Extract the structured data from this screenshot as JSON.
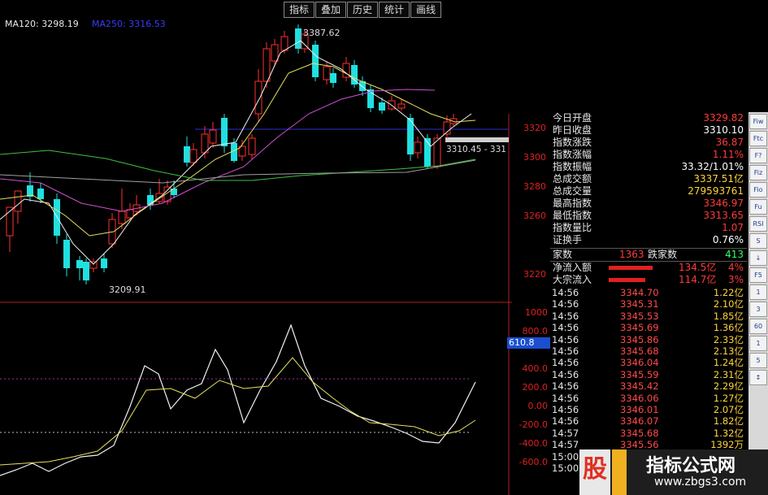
{
  "toolbar": {
    "tabs": [
      "指标",
      "叠加",
      "历史",
      "统计",
      "画线"
    ]
  },
  "ma_labels": [
    {
      "text": "MA120: 3298.19",
      "color": "#e8e8e8"
    },
    {
      "text": "MA250: 3316.53",
      "color": "#3a3aff"
    }
  ],
  "price_annotations": {
    "high": "3387.62",
    "low": "3209.91",
    "current": "3310.45 - 331"
  },
  "price_axis": [
    "3320",
    "3300",
    "3280",
    "3260",
    "3220"
  ],
  "indicator_axis": [
    "1000",
    "800.0",
    "600.0",
    "400.0",
    "200.0",
    "0.00",
    "-200.0",
    "-400.0",
    "-600.0"
  ],
  "indicator_highlight": "610.8",
  "colors": {
    "up": "#ff3030",
    "down": "#20e0e0",
    "ma5": "#f0f0f0",
    "ma10": "#e8e060",
    "ma20": "#d050d0",
    "ma60": "#40c040"
  },
  "panel": {
    "stats": [
      {
        "label": "今日开盘",
        "value": "3329.82",
        "color": "#ff3a3a"
      },
      {
        "label": "昨日收盘",
        "value": "3310.10",
        "color": "#ffffff"
      },
      {
        "label": "指数涨跌",
        "value": "36.87",
        "color": "#ff3a3a"
      },
      {
        "label": "指数涨幅",
        "value": "1.11%",
        "color": "#ff3a3a"
      },
      {
        "label": "指数振幅",
        "value": "33.32/1.01%",
        "color": "#ffffff"
      },
      {
        "label": "总成交额",
        "value": "3337.51亿",
        "color": "#ffd43a"
      },
      {
        "label": "总成交量",
        "value": "279593761",
        "color": "#ffd43a"
      },
      {
        "label": "最高指数",
        "value": "3346.97",
        "color": "#ff3a3a"
      },
      {
        "label": "最低指数",
        "value": "3313.65",
        "color": "#ff3a3a"
      },
      {
        "label": "指数量比",
        "value": "1.07",
        "color": "#ff3a3a"
      },
      {
        "label": "证换手",
        "value": "0.76%",
        "color": "#ffffff"
      }
    ],
    "breadth": {
      "up_label": "家数",
      "up_value": "1363",
      "down_label": "跌家数",
      "down_value": "413"
    },
    "flows": [
      {
        "label": "净流入额",
        "value": "134.5亿",
        "pct": "4%",
        "bar": 0.9
      },
      {
        "label": "大宗流入",
        "value": "114.7亿",
        "pct": "3%",
        "bar": 0.75
      }
    ],
    "ticks": [
      [
        "14:56",
        "3344.70",
        "1.22亿"
      ],
      [
        "14:56",
        "3345.31",
        "2.10亿"
      ],
      [
        "14:56",
        "3345.53",
        "1.85亿"
      ],
      [
        "14:56",
        "3345.69",
        "1.36亿"
      ],
      [
        "14:56",
        "3345.86",
        "2.33亿"
      ],
      [
        "14:56",
        "3345.68",
        "2.13亿"
      ],
      [
        "14:56",
        "3346.04",
        "1.24亿"
      ],
      [
        "14:56",
        "3345.59",
        "2.31亿"
      ],
      [
        "14:56",
        "3345.42",
        "2.29亿"
      ],
      [
        "14:56",
        "3346.06",
        "1.27亿"
      ],
      [
        "14:56",
        "3346.01",
        "2.07亿"
      ],
      [
        "14:56",
        "3346.07",
        "1.82亿"
      ],
      [
        "14:57",
        "3345.68",
        "1.32亿"
      ],
      [
        "14:57",
        "3345.56",
        "1392万"
      ],
      [
        "15:00",
        "",
        ""
      ],
      [
        "15:00",
        "",
        ""
      ]
    ]
  },
  "sidebar_buttons": [
    "Fiw",
    "Ftc",
    "F?",
    "Fiz",
    "Fio",
    "Fu",
    "RSI",
    "S",
    "↓",
    "F5",
    "1",
    "3",
    "60",
    "1",
    "5",
    "↕"
  ],
  "watermark": {
    "left": "股",
    "brand": "指标公式网",
    "url": "www.zbgs3.com"
  }
}
